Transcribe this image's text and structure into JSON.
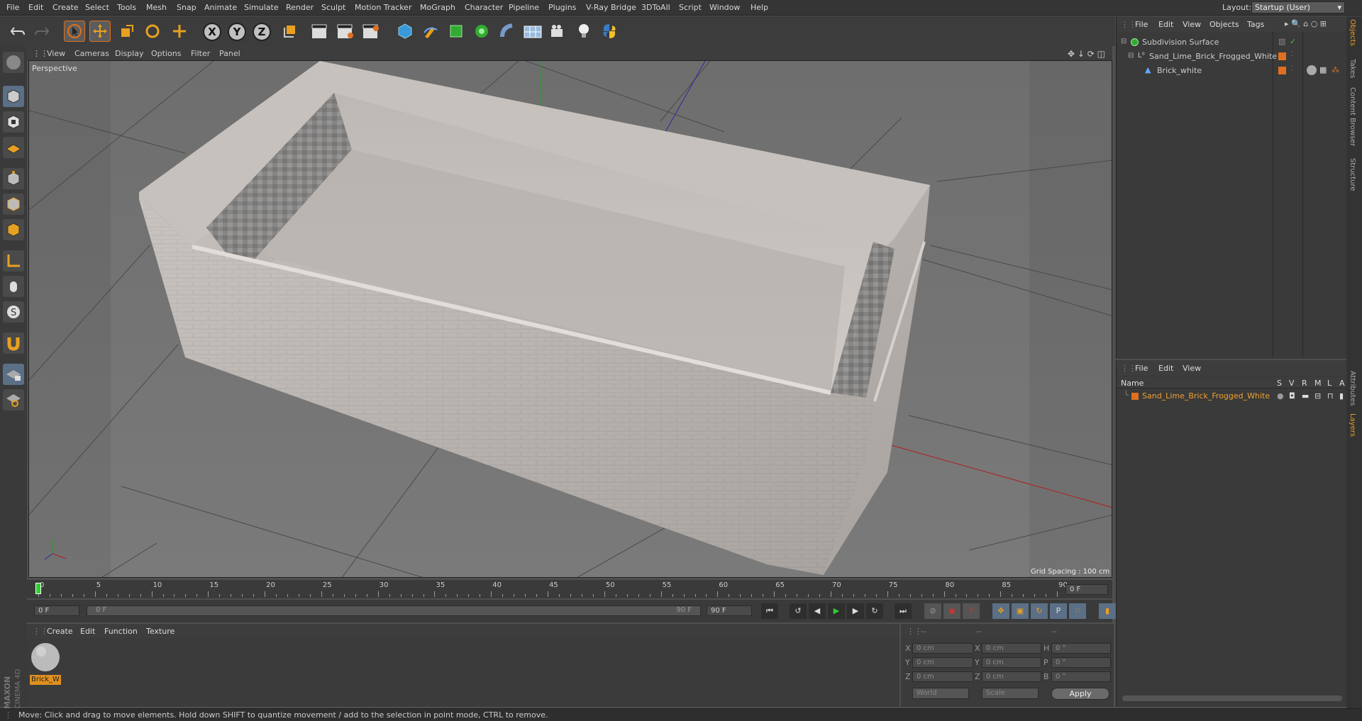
{
  "menubar": {
    "items": [
      "File",
      "Edit",
      "Create",
      "Select",
      "Tools",
      "Mesh",
      "Snap",
      "Animate",
      "Simulate",
      "Render",
      "Sculpt",
      "Motion Tracker",
      "MoGraph",
      "Character",
      "Pipeline",
      "Plugins",
      "V-Ray Bridge",
      "3DToAll",
      "Script",
      "Window",
      "Help"
    ],
    "layout_label": "Layout:",
    "layout_value": "Startup (User)"
  },
  "toolbar": {
    "axis_x": "X",
    "axis_y": "Y",
    "axis_z": "Z"
  },
  "viewport": {
    "menu": [
      "View",
      "Cameras",
      "Display",
      "Options",
      "Filter",
      "Panel"
    ],
    "label": "Perspective",
    "grid_spacing": "Grid Spacing : 100 cm"
  },
  "timeline": {
    "ticks": [
      "0",
      "5",
      "10",
      "15",
      "20",
      "25",
      "30",
      "35",
      "40",
      "45",
      "50",
      "55",
      "60",
      "65",
      "70",
      "75",
      "80",
      "85",
      "90"
    ],
    "current_frame_field": "0 F",
    "start_field": "0 F",
    "range_start": "0 F",
    "range_end": "90 F",
    "end_field": "90 F"
  },
  "material_panel": {
    "menu": [
      "Create",
      "Edit",
      "Function",
      "Texture"
    ],
    "material_name": "Brick_W"
  },
  "coords": {
    "headers": [
      "--",
      "--",
      "--"
    ],
    "rows": [
      {
        "a": "X",
        "av": "0 cm",
        "b": "X",
        "bv": "0 cm",
        "c": "H",
        "cv": "0 °"
      },
      {
        "a": "Y",
        "av": "0 cm",
        "b": "Y",
        "bv": "0 cm",
        "c": "P",
        "cv": "0 °"
      },
      {
        "a": "Z",
        "av": "0 cm",
        "b": "Z",
        "bv": "0 cm",
        "c": "B",
        "cv": "0 °"
      }
    ],
    "mode1": "World",
    "mode2": "Scale",
    "apply": "Apply"
  },
  "object_manager": {
    "menu": [
      "File",
      "Edit",
      "View",
      "Objects",
      "Tags"
    ],
    "objects": [
      "Subdivision Surface",
      "Sand_Lime_Brick_Frogged_White",
      "Brick_white"
    ]
  },
  "layer_manager": {
    "menu": [
      "File",
      "Edit",
      "View"
    ],
    "columns": [
      "Name",
      "S",
      "V",
      "R",
      "M",
      "L",
      "A"
    ],
    "layers": [
      "Sand_Lime_Brick_Frogged_White"
    ]
  },
  "side_tabs": [
    "Objects",
    "Takes",
    "Content Browser",
    "Structure",
    "Attributes",
    "Layers"
  ],
  "status": "Move: Click and drag to move elements. Hold down SHIFT to quantize movement / add to the selection in point mode, CTRL to remove.",
  "brand": {
    "maxon": "MAXON",
    "product": "CINEMA 4D"
  },
  "colors": {
    "accent": "#e07020",
    "selected_text": "#f0a030",
    "background": "#4f4f4f"
  }
}
